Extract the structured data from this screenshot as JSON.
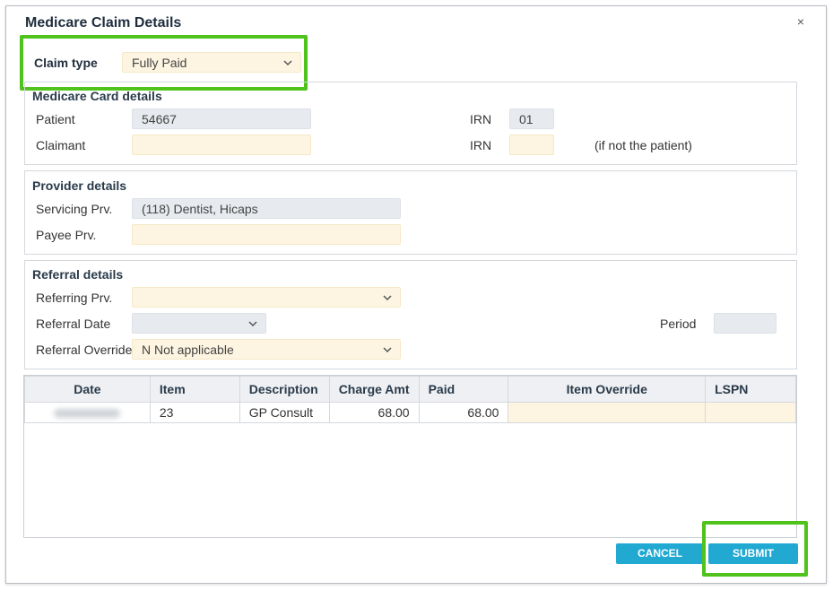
{
  "dialog": {
    "title": "Medicare Claim Details",
    "close_symbol": "×"
  },
  "claim_type": {
    "label": "Claim type",
    "value": "Fully Paid"
  },
  "medicare_card": {
    "title": "Medicare Card details",
    "patient_label": "Patient",
    "patient_value": "54667",
    "patient_irn_label": "IRN",
    "patient_irn_value": "01",
    "claimant_label": "Claimant",
    "claimant_value": "",
    "claimant_irn_label": "IRN",
    "claimant_irn_value": "",
    "claimant_note": "(if not the patient)"
  },
  "provider": {
    "title": "Provider details",
    "servicing_label": "Servicing Prv.",
    "servicing_value": "(118) Dentist, Hicaps",
    "payee_label": "Payee Prv.",
    "payee_value": ""
  },
  "referral": {
    "title": "Referral details",
    "referring_label": "Referring Prv.",
    "referring_value": "",
    "date_label": "Referral Date",
    "date_value": "",
    "period_label": "Period",
    "period_value": "",
    "override_label": "Referral Override",
    "override_value": "N Not applicable"
  },
  "table": {
    "headers": [
      "Date",
      "Item",
      "Description",
      "Charge Amt",
      "Paid",
      "Item Override",
      "LSPN"
    ],
    "rows": [
      {
        "date": "",
        "item": "23",
        "description": "GP Consult",
        "charge": "68.00",
        "paid": "68.00",
        "override": "",
        "lspn": ""
      }
    ]
  },
  "buttons": {
    "cancel": "CANCEL",
    "submit": "SUBMIT"
  },
  "colors": {
    "accent": "#21a9d2",
    "highlight": "#4fc21b",
    "field_yellow": "#fdf5e1",
    "field_gray": "#e7eaee"
  },
  "icons": {
    "dropdown": "chevron-down-icon",
    "close": "close-icon"
  }
}
